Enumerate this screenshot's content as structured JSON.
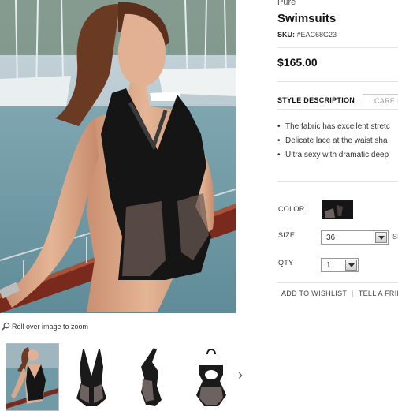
{
  "product": {
    "brand": "Pure",
    "title": "Swimsuits",
    "sku_label": "SKU:",
    "sku_value": "#EAC68G23",
    "price": "$165.00"
  },
  "tabs": {
    "style_description": "STYLE DESCRIPTION",
    "care": "CARE I"
  },
  "description": {
    "bullets": [
      "The fabric has excellent stretc",
      "Delicate lace at the waist sha",
      "Ultra sexy with dramatic deep"
    ]
  },
  "options": {
    "color_label": "COLOR",
    "size_label": "SIZE",
    "size_value": "36",
    "size_extra": "SI",
    "qty_label": "QTY",
    "qty_value": "1"
  },
  "actions": {
    "wishlist": "ADD TO WISHLIST",
    "tell_friend": "TELL A FRIE"
  },
  "zoom_hint": "Roll over image to zoom",
  "colors": {
    "swimsuit": "#151515",
    "sea": "#6f9aa6",
    "railing": "#7a2a1c",
    "skin": "#d9a88a"
  }
}
